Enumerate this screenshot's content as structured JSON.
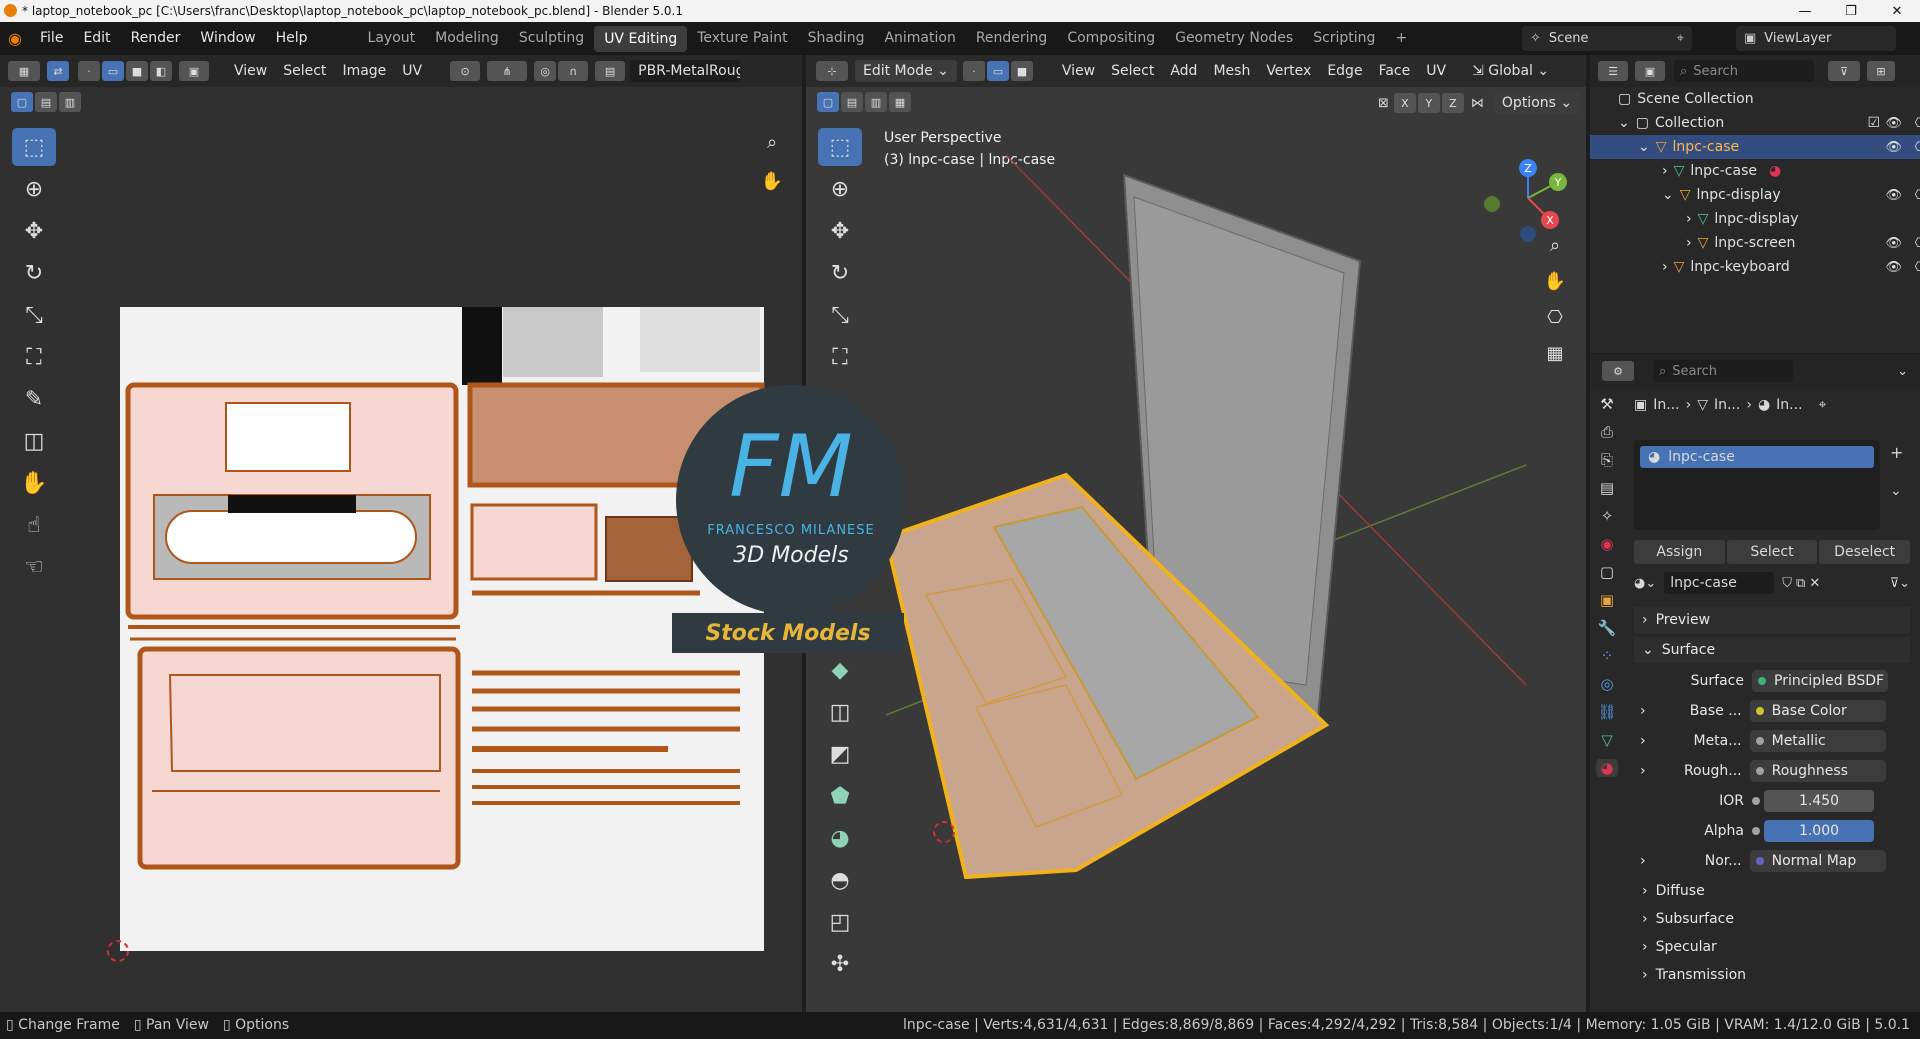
{
  "window": {
    "title": "* laptop_notebook_pc [C:\\Users\\franc\\Desktop\\laptop_notebook_pc\\laptop_notebook_pc.blend] - Blender 5.0.1"
  },
  "menu": [
    "File",
    "Edit",
    "Render",
    "Window",
    "Help"
  ],
  "workspaces": [
    "Layout",
    "Modeling",
    "Sculpting",
    "UV Editing",
    "Texture Paint",
    "Shading",
    "Animation",
    "Rendering",
    "Compositing",
    "Geometry Nodes",
    "Scripting"
  ],
  "active_workspace": "UV Editing",
  "scene": {
    "label": "Scene",
    "view_layer": "ViewLayer"
  },
  "uv_editor": {
    "menus": [
      "View",
      "Select",
      "Image",
      "UV"
    ],
    "image_name": "PBR-MetalRougl"
  },
  "viewport": {
    "mode": "Edit Mode",
    "menus": [
      "View",
      "Select",
      "Add",
      "Mesh",
      "Vertex",
      "Edge",
      "Face",
      "UV"
    ],
    "orientation": "Global",
    "axes": [
      "X",
      "Y",
      "Z"
    ],
    "options_label": "Options",
    "overlay_line1": "User Perspective",
    "overlay_line2": "(3) lnpc-case | lnpc-case",
    "gizmo": {
      "x": "X",
      "y": "Y",
      "z": "Z"
    }
  },
  "watermark": {
    "logo": "FM",
    "name": "FRANCESCO MILANESE",
    "sub": "3D Models",
    "banner": "Stock Models"
  },
  "outliner": {
    "search_placeholder": "Search",
    "scene_collection": "Scene Collection",
    "collection": "Collection",
    "rows": [
      "lnpc-case",
      "lnpc-case",
      "lnpc-display",
      "lnpc-display",
      "lnpc-screen",
      "lnpc-keyboard"
    ]
  },
  "properties": {
    "search_placeholder": "Search",
    "breadcrumb": [
      "In...",
      "In...",
      "In..."
    ],
    "material_slot": "lnpc-case",
    "buttons": {
      "assign": "Assign",
      "select": "Select",
      "deselect": "Deselect"
    },
    "material_name": "lnpc-case",
    "sections": {
      "preview": "Preview",
      "surface": "Surface",
      "diffuse": "Diffuse",
      "subsurface": "Subsurface",
      "specular": "Specular",
      "transmission": "Transmission"
    },
    "surface_label": "Surface",
    "surface_value": "Principled BSDF",
    "inputs": [
      {
        "label": "Base ...",
        "value": "Base Color",
        "color": "#c7c729"
      },
      {
        "label": "Meta...",
        "value": "Metallic",
        "color": "#a1a1a1"
      },
      {
        "label": "Rough...",
        "value": "Roughness",
        "color": "#a1a1a1"
      }
    ],
    "ior_label": "IOR",
    "ior_value": "1.450",
    "alpha_label": "Alpha",
    "alpha_value": "1.000",
    "normal_label": "Nor...",
    "normal_value": "Normal Map"
  },
  "status": {
    "hints": [
      "Change Frame",
      "Pan View",
      "Options"
    ],
    "info": "lnpc-case | Verts:4,631/4,631 | Edges:8,869/8,869 | Faces:4,292/4,292 | Tris:8,584 | Objects:1/4 | Memory: 1.05 GiB | VRAM: 1.4/12.0 GiB | 5.0.1"
  },
  "colors": {
    "accent": "#4772b3",
    "selection": "#e8a33d",
    "uv_edge": "#b0561b"
  }
}
